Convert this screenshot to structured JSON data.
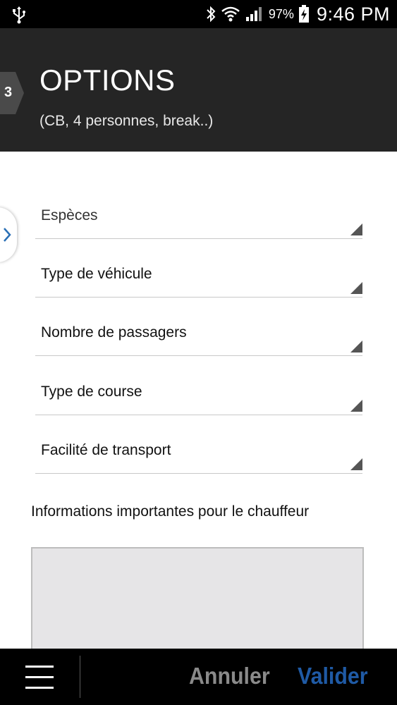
{
  "status_bar": {
    "battery_percent": "97%",
    "time": "9:46 PM",
    "icons": [
      "usb-icon",
      "bluetooth-icon",
      "wifi-icon",
      "signal-icon",
      "battery-icon"
    ]
  },
  "header": {
    "step": "3",
    "title": "OPTIONS",
    "subtitle": "(CB, 4 personnes, break..)"
  },
  "fields": [
    {
      "label": "Espèces"
    },
    {
      "label": "Type de véhicule"
    },
    {
      "label": "Nombre de passagers"
    },
    {
      "label": "Type de course"
    },
    {
      "label": "Facilité de transport"
    }
  ],
  "driver_info": {
    "label": "Informations importantes pour le chauffeur",
    "value": ""
  },
  "bottom_bar": {
    "cancel_label": "Annuler",
    "validate_label": "Valider"
  },
  "colors": {
    "header_bg": "#252525",
    "validate": "#1f5aa5",
    "cancel": "#8a8a8a"
  }
}
